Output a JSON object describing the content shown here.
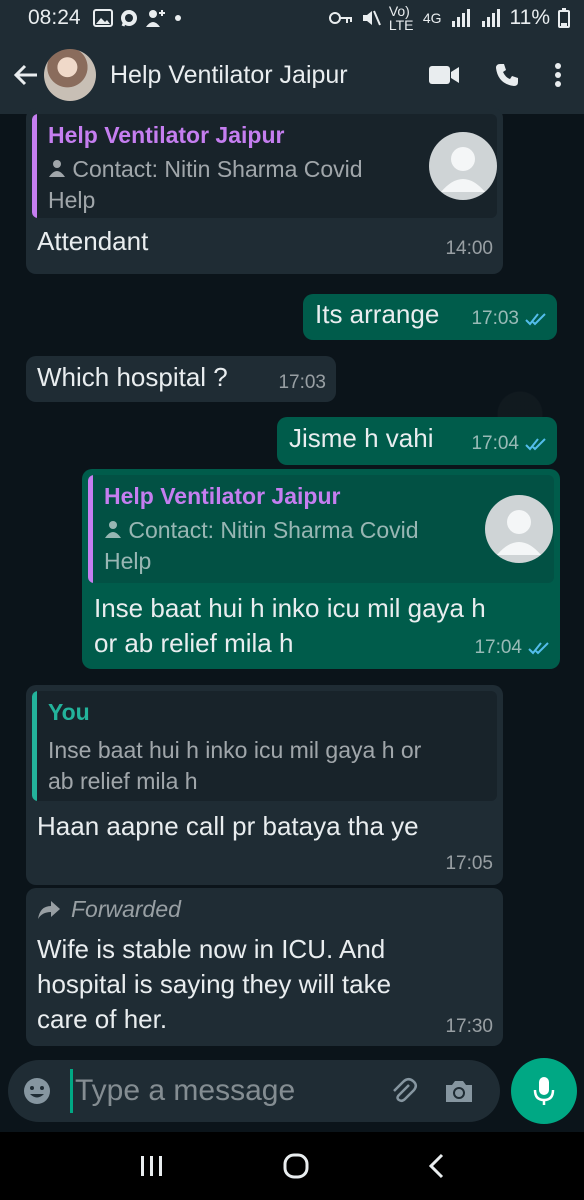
{
  "status_bar": {
    "time": "08:24",
    "network_label": "Vo) LTE",
    "network_type": "4G",
    "battery": "11%"
  },
  "header": {
    "title": "Help Ventilator Jaipur",
    "icons": [
      "back-arrow-icon",
      "video-call-icon",
      "voice-call-icon",
      "more-options-icon"
    ]
  },
  "messages": [
    {
      "direction": "in",
      "quote_name": "Help Ventilator Jaipur",
      "quote_line1": "Contact: Nitin Sharma Covid",
      "quote_line2": "Help",
      "text": "Attendant",
      "time": "14:00"
    },
    {
      "direction": "out",
      "text": "Its arrange",
      "time": "17:03",
      "status": "read"
    },
    {
      "direction": "in",
      "text": "Which hospital ?",
      "time": "17:03"
    },
    {
      "direction": "out",
      "text": "Jisme h vahi",
      "time": "17:04",
      "status": "read"
    },
    {
      "direction": "out",
      "quote_name": "Help Ventilator Jaipur",
      "quote_line1": "Contact: Nitin Sharma Covid",
      "quote_line2": "Help",
      "text_line1": "Inse baat hui h inko icu mil gaya h",
      "text_line2": "or ab relief mila h",
      "time": "17:04",
      "status": "read"
    },
    {
      "direction": "in",
      "quote_name": "You",
      "quote_line1": "Inse baat hui h inko icu mil gaya h or",
      "quote_line2": "ab relief mila h",
      "text": "Haan aapne call pr bataya tha ye",
      "time": "17:05"
    },
    {
      "direction": "in",
      "forwarded_label": "Forwarded",
      "text_line1": "Wife is stable now in ICU. And",
      "text_line2": "hospital is saying they will take",
      "text_line3": "care of her.",
      "time": "17:30"
    }
  ],
  "input_bar": {
    "placeholder": "Type a message"
  },
  "colors": {
    "background": "#0b141a",
    "incoming_bubble": "#1f2c34",
    "outgoing_bubble": "#005c4b",
    "accent": "#00a884",
    "read_ticks": "#53bdeb",
    "quote_name_purple": "#c57ef0",
    "quote_name_teal": "#23b39b"
  }
}
